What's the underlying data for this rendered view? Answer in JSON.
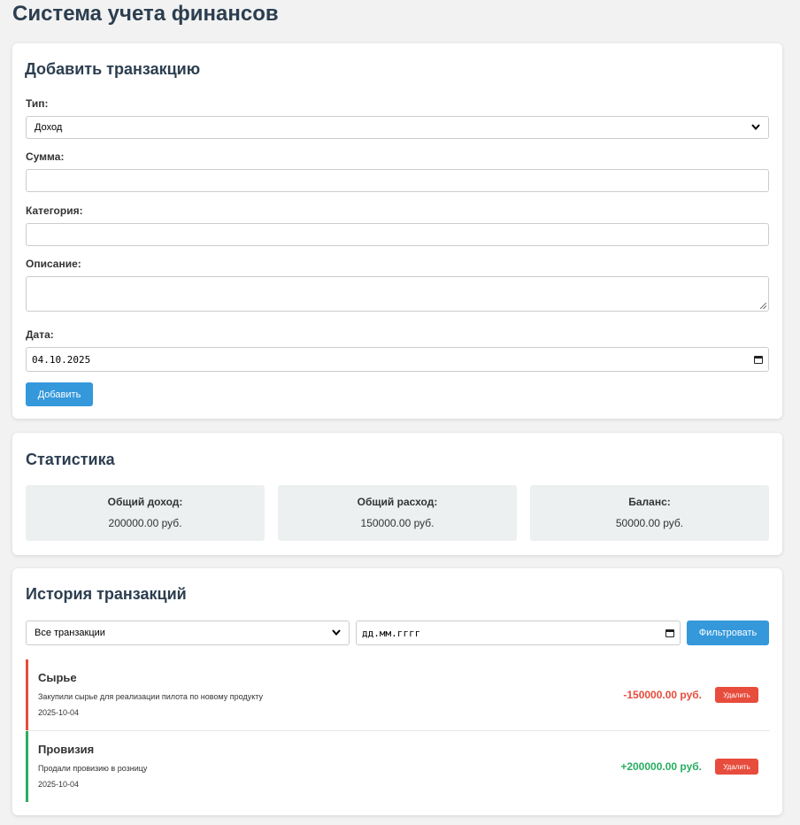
{
  "page": {
    "title": "Система учета финансов"
  },
  "add_form": {
    "heading": "Добавить транзакцию",
    "type_label": "Тип:",
    "type_value": "Доход",
    "amount_label": "Сумма:",
    "amount_value": "",
    "category_label": "Категория:",
    "category_value": "",
    "description_label": "Описание:",
    "description_value": "",
    "date_label": "Дата:",
    "date_value": "04.10.2025",
    "submit_label": "Добавить"
  },
  "stats": {
    "heading": "Статистика",
    "items": [
      {
        "label": "Общий доход:",
        "value": "200000.00 руб."
      },
      {
        "label": "Общий расход:",
        "value": "150000.00 руб."
      },
      {
        "label": "Баланс:",
        "value": "50000.00 руб."
      }
    ]
  },
  "history": {
    "heading": "История транзакций",
    "filter_type_value": "Все транзакции",
    "filter_date_placeholder": "дд.мм.гггг",
    "filter_button_label": "Фильтровать",
    "transactions": [
      {
        "title": "Сырье",
        "description": "Закупили сырье для реализации пилота по новому продукту",
        "date": "2025-10-04",
        "amount": "-150000.00 руб.",
        "kind": "expense",
        "delete_label": "Удалить"
      },
      {
        "title": "Провизия",
        "description": "Продали провизию в розницу",
        "date": "2025-10-04",
        "amount": "+200000.00 руб.",
        "kind": "income",
        "delete_label": "Удалить"
      }
    ]
  },
  "colors": {
    "primary": "#3498db",
    "heading": "#2c3e50",
    "expense": "#e74c3c",
    "income": "#27ae60",
    "stat_bg": "#ecf0f1",
    "page_bg": "#f2f2f2"
  },
  "icons": {
    "select_arrow": "chevron-down-icon",
    "date_picker": "calendar-icon"
  }
}
